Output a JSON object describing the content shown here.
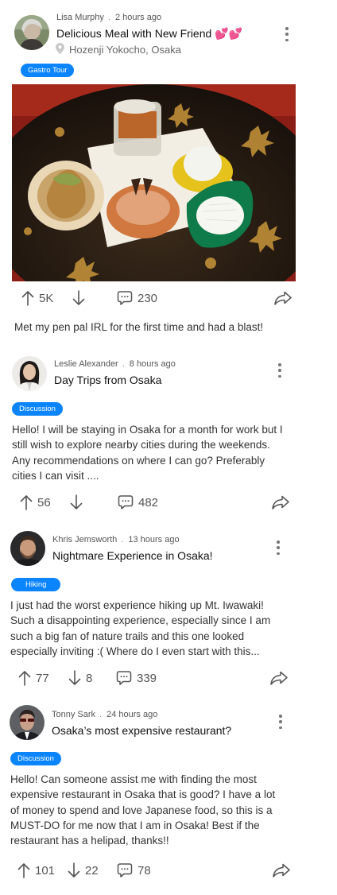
{
  "colors": {
    "accent": "#0a84ff",
    "text": "#333333",
    "muted": "#666666"
  },
  "posts": [
    {
      "author": "Lisa Murphy",
      "time": "2 hours ago",
      "title": "Delicious Meal with New Friend 💕💕",
      "location": "Hozenji Yokocho, Osaka",
      "tag": "Gastro Tour",
      "caption": "Met my pen pal IRL for the first time and had a blast!",
      "upvotes": "5K",
      "comments": "230"
    },
    {
      "author": "Leslie Alexander",
      "time": "8 hours ago",
      "title": "Day Trips from Osaka",
      "tag": "Discussion",
      "body": "Hello! I will be staying in Osaka for a month for work but I still wish to explore nearby cities during the weekends. Any recommendations on where I can go? Preferably cities I can visit ....",
      "upvotes": "56",
      "comments": "482"
    },
    {
      "author": "Khris Jemsworth",
      "time": "13 hours ago",
      "title": "Nightmare Experience in Osaka!",
      "tag": "Hiking",
      "body": "I just had the worst experience hiking up Mt. Iwawaki! Such a disappointing experience, especially since I am such a big fan of nature trails and this one looked especially inviting :( Where do I even start with this...",
      "upvotes": "77",
      "downvotes": "8",
      "comments": "339"
    },
    {
      "author": "Tonny Sark",
      "time": "24 hours ago",
      "title": "Osaka’s most expensive restaurant?",
      "tag": "Discussion",
      "body": "Hello! Can someone assist me with finding the most expensive restaurant in Osaka that is good? I have a lot of money to spend and love Japanese food, so this is a MUST-DO for me now that I am in Osaka! Best if the restaurant has a helipad, thanks!!",
      "upvotes": "101",
      "downvotes": "22",
      "comments": "78"
    }
  ]
}
